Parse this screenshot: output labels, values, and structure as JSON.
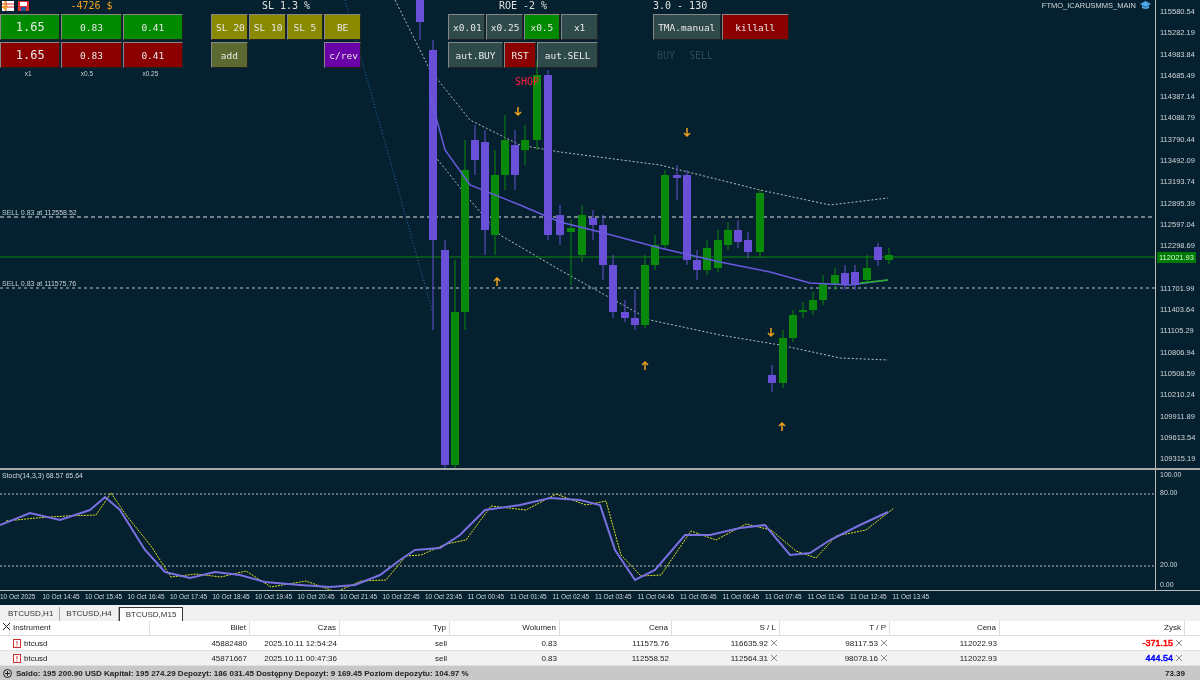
{
  "account": "FTMO_ICARUSMMS_MAIN",
  "panel": {
    "groups": [
      {
        "title": "-4726 $",
        "rows": [
          [
            {
              "label": "1.65",
              "kind": "buy"
            },
            {
              "label": "0.83",
              "kind": "buy"
            },
            {
              "label": "0.41",
              "kind": "buy"
            }
          ],
          [
            {
              "label": "1.65",
              "kind": "sell"
            },
            {
              "label": "0.83",
              "kind": "sell"
            },
            {
              "label": "0.41",
              "kind": "sell"
            }
          ]
        ],
        "captions": [
          "x1",
          "x0.5",
          "x0.25"
        ]
      },
      {
        "title": "SL 1.3 %",
        "rows": [
          [
            {
              "label": "SL 20",
              "kind": "olive"
            },
            {
              "label": "SL 10",
              "kind": "olive"
            },
            {
              "label": "SL 5",
              "kind": "olive"
            },
            {
              "label": "BE",
              "kind": "olive"
            }
          ],
          [
            {
              "label": "add",
              "kind": "moss"
            },
            "",
            "",
            {
              "label": "c/rev",
              "kind": "purple"
            }
          ]
        ]
      },
      {
        "title": "ROE -2 %",
        "rows": [
          [
            {
              "label": "x0.01",
              "kind": "grey",
              "selected": false
            },
            {
              "label": "x0.25",
              "kind": "grey",
              "selected": false
            },
            {
              "label": "x0.5",
              "kind": "grey",
              "selected": true
            },
            {
              "label": "x1",
              "kind": "grey",
              "selected": false
            }
          ],
          [
            {
              "label": "aut.BUY",
              "kind": "grey"
            },
            {
              "label": "RST",
              "kind": "sell"
            },
            {
              "label": "aut.SELL",
              "kind": "grey"
            }
          ]
        ]
      },
      {
        "title": "3.0 - 130",
        "rows": [
          [
            {
              "label": "TMA.manual",
              "kind": "grey"
            },
            {
              "label": "killall",
              "kind": "sell"
            }
          ]
        ],
        "status": [
          "BUY",
          "SELL"
        ]
      }
    ]
  },
  "chart": {
    "signal": "SHOP",
    "order_lines": [
      {
        "text": "SELL 0.83 at 112558.52"
      },
      {
        "text": "SELL 0.83 at 111575.76"
      }
    ],
    "price_axis": [
      "115580.54",
      "115282.19",
      "114983.84",
      "114685.49",
      "114387.14",
      "114088.79",
      "113790.44",
      "113492.09",
      "113193.74",
      "112895.39",
      "112597.04",
      "112298.69",
      "111701.99",
      "111403.64",
      "111105.29",
      "110806.94",
      "110508.59",
      "110210.24",
      "109911.89",
      "109613.54",
      "109315.19"
    ],
    "current_price": "112021.93"
  },
  "stoch": {
    "label": "Stoch(14,3,3) 68.57 65.64",
    "axis": [
      "100.00",
      "80.00",
      "20.00",
      "0.00"
    ]
  },
  "time_axis": [
    "10 Oct 2025",
    "10 Oct 14:45",
    "10 Oct 15:45",
    "10 Oct 16:45",
    "10 Oct 17:45",
    "10 Oct 18:45",
    "10 Oct 19:45",
    "10 Oct 20:45",
    "10 Oct 21:45",
    "10 Oct 22:45",
    "10 Oct 23:45",
    "11 Oct 00:45",
    "11 Oct 01:45",
    "11 Oct 02:45",
    "11 Oct 03:45",
    "11 Oct 04:45",
    "11 Oct 05:45",
    "11 Oct 06:45",
    "11 Oct 07:45",
    "11 Oct 11:45",
    "11 Oct 12:45",
    "11 Oct 13:45"
  ],
  "tabs": [
    {
      "label": "BTCUSD,H1",
      "selected": false
    },
    {
      "label": "BTCUSD,H4",
      "selected": false
    },
    {
      "label": "BTCUSD,M15",
      "selected": true
    }
  ],
  "table": {
    "columns": [
      "Instrument",
      "Bilet",
      "Czas",
      "Typ",
      "Wolumen",
      "Cena",
      "S / L",
      "T / P",
      "Cena",
      "Zysk"
    ],
    "rows": [
      {
        "cells": [
          "btcusd",
          "45882480",
          "2025.10.11 12:54:24",
          "sell",
          "0.83",
          "111575.76",
          "116635.92",
          "98117.53",
          "112022.93",
          "-371.15"
        ],
        "color": "#ff0000"
      },
      {
        "cells": [
          "btcusd",
          "45871667",
          "2025.10.11 00:47:36",
          "sell",
          "0.83",
          "112558.52",
          "112564.31",
          "98078.16",
          "112022.93",
          "444.54"
        ],
        "color": "#0000ff"
      }
    ],
    "summary": "Saldo: 195 200.90 USD  Kapitał: 195 274.29  Depozyt: 186 031.45  Dostępny Depozyt: 9 169.45  Poziom depozytu: 104.97 %",
    "total": "73.39"
  }
}
